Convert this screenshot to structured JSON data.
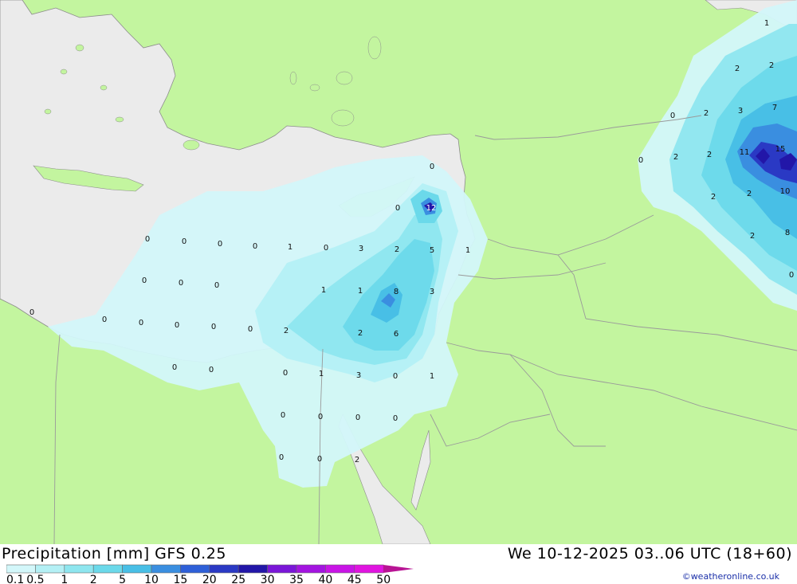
{
  "title": "Precipitation [mm] GFS 0.25",
  "datetime": "We 10-12-2025 03..06 UTC (18+60)",
  "credit": "©weatheronline.co.uk",
  "colors": {
    "sea": "#ebebeb",
    "land": "#c3f59f",
    "border": "#9a9a9a"
  },
  "legend": {
    "labels": [
      "0.1",
      "0.5",
      "1",
      "2",
      "5",
      "10",
      "15",
      "20",
      "25",
      "30",
      "35",
      "40",
      "45",
      "50"
    ],
    "colors": [
      "#d3f7fa",
      "#b4f0f5",
      "#8ee6ef",
      "#6bd9ea",
      "#48bfe6",
      "#3a8ee0",
      "#2e5fd8",
      "#2a39c4",
      "#2216a8",
      "#7a16d8",
      "#a314e0",
      "#c814e6",
      "#e014e0",
      "#b81494"
    ]
  },
  "values": [
    "1",
    "2",
    "2",
    "7",
    "0",
    "2",
    "3",
    "11",
    "15",
    "0",
    "2",
    "2",
    "2",
    "10",
    "2",
    "2",
    "8",
    "0",
    "0",
    "12",
    "0",
    "0",
    "0",
    "0",
    "0",
    "1",
    "0",
    "3",
    "2",
    "5",
    "1",
    "0",
    "0",
    "0",
    "1",
    "1",
    "8",
    "3",
    "0",
    "0",
    "0",
    "0",
    "0",
    "0",
    "2",
    "2",
    "6",
    "0",
    "0",
    "0",
    "1",
    "3",
    "0",
    "1",
    "0",
    "0",
    "0",
    "0",
    "0",
    "0",
    "2"
  ]
}
